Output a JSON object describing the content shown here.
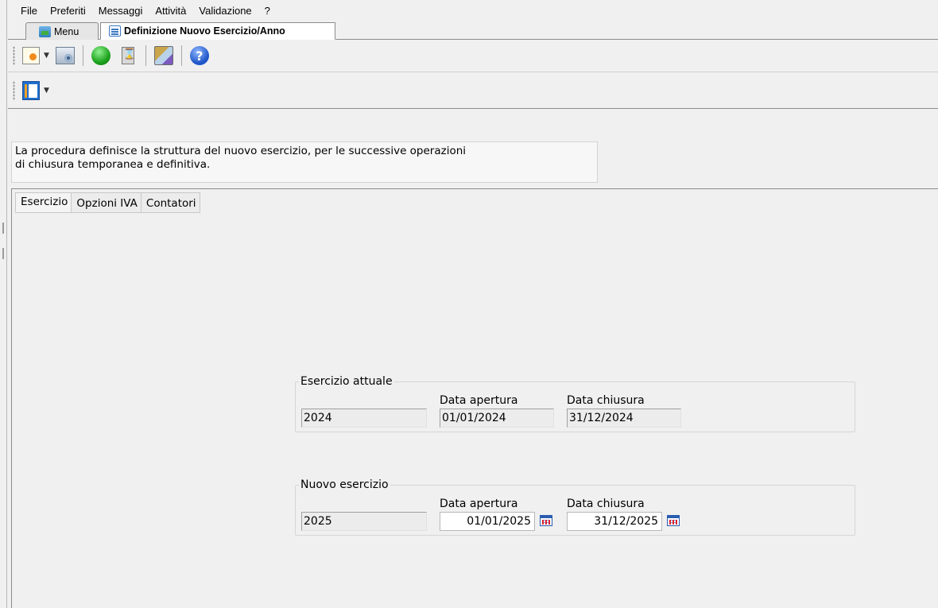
{
  "menubar": [
    "File",
    "Preferiti",
    "Messaggi",
    "Attività",
    "Validazione",
    "?"
  ],
  "window_tabs": {
    "menu": "Menu",
    "active": "Definizione Nuovo Esercizio/Anno"
  },
  "toolbar": {
    "icons": [
      "new-document-icon",
      "dropdown-arrow-icon",
      "settings-icon",
      "execute-green-icon",
      "hourglass-icon",
      "tools-icon",
      "help-icon"
    ],
    "second_icons": [
      "layout-icon",
      "dropdown-arrow-icon"
    ]
  },
  "info_text": {
    "line1": "La procedura definisce la struttura del nuovo esercizio, per le successive operazioni",
    "line2": "di chiusura temporanea e definitiva."
  },
  "inner_tabs": [
    "Esercizio",
    "Opzioni IVA",
    "Contatori"
  ],
  "current_year": {
    "legend": "Esercizio attuale",
    "year": "2024",
    "open_label": "Data apertura",
    "open_date": "01/01/2024",
    "close_label": "Data chiusura",
    "close_date": "31/12/2024"
  },
  "new_year": {
    "legend": "Nuovo esercizio",
    "year": "2025",
    "open_label": "Data apertura",
    "open_date": "01/01/2025",
    "close_label": "Data chiusura",
    "close_date": "31/12/2025"
  }
}
